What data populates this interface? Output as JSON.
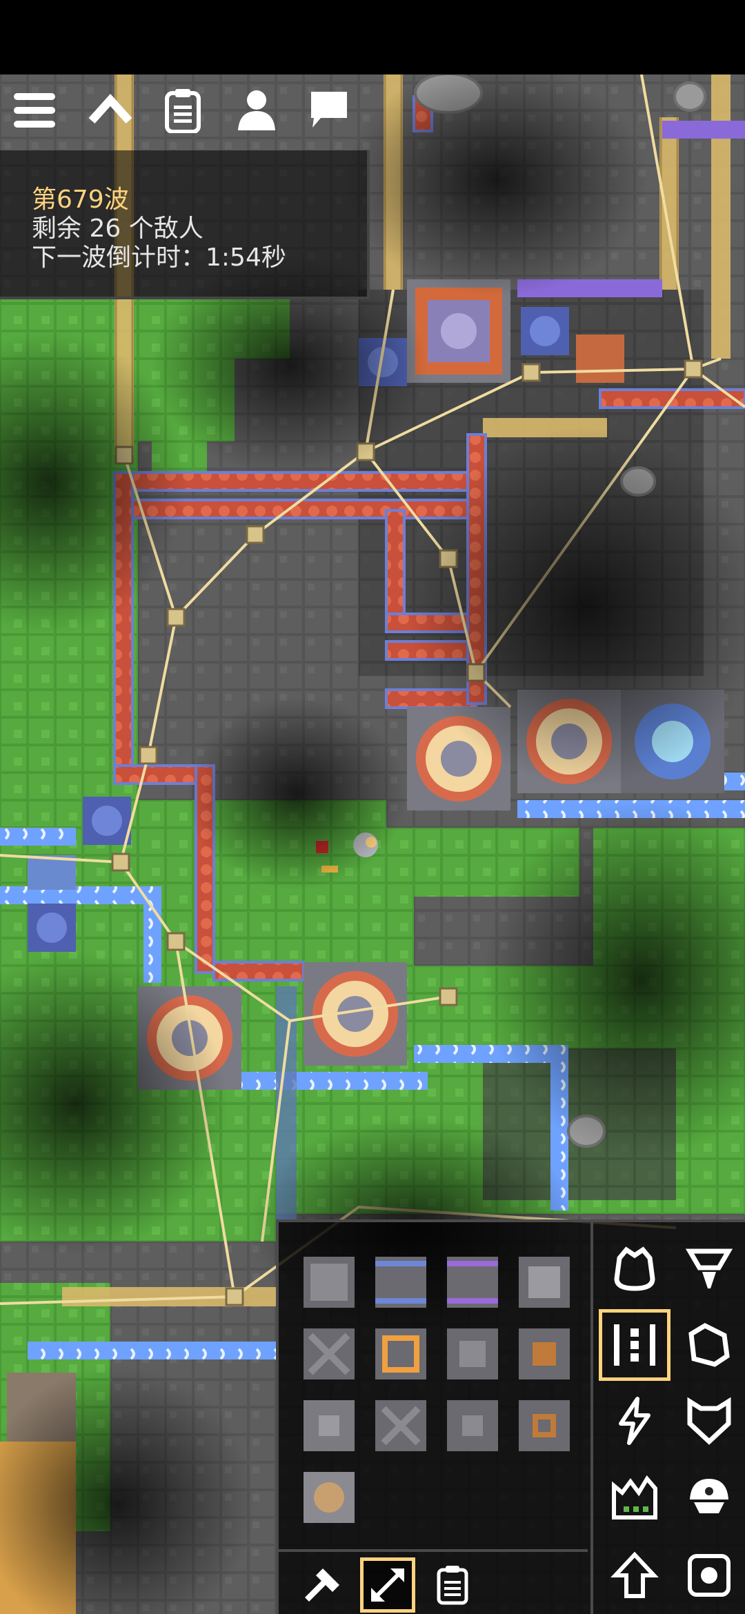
{
  "hud": {
    "wave_title": "第679波",
    "enemies_remaining": "剩余 26 个敌人",
    "next_wave_countdown": "下一波倒计时：1:54秒"
  },
  "top_bar": {
    "icons": [
      "menu-icon",
      "chevron-up-icon",
      "clipboard-icon",
      "player-icon",
      "chat-icon"
    ]
  },
  "build_panel": {
    "categories": [
      {
        "icon": "turret-icon",
        "selected": false
      },
      {
        "icon": "drill-icon",
        "selected": false
      },
      {
        "icon": "distribution-icon",
        "selected": true
      },
      {
        "icon": "liquid-icon",
        "selected": false
      },
      {
        "icon": "power-icon",
        "selected": false
      },
      {
        "icon": "defense-icon",
        "selected": false
      },
      {
        "icon": "crafting-icon",
        "selected": false
      },
      {
        "icon": "units-icon",
        "selected": false
      }
    ],
    "modes": [
      {
        "icon": "hammer-icon",
        "selected": false
      },
      {
        "icon": "expand-icon",
        "selected": true
      },
      {
        "icon": "schematic-icon",
        "selected": false
      }
    ],
    "right_actions": [
      "upgrade-arrow-icon",
      "rotate-icon"
    ]
  },
  "colors": {
    "accent": "#ffd37f",
    "grass": "#4f9e3a",
    "stone": "#5a5a5a",
    "conveyor_red": "#d65a3c",
    "conduit_blue": "#7aa6ff",
    "power_line": "#f0dca0"
  }
}
